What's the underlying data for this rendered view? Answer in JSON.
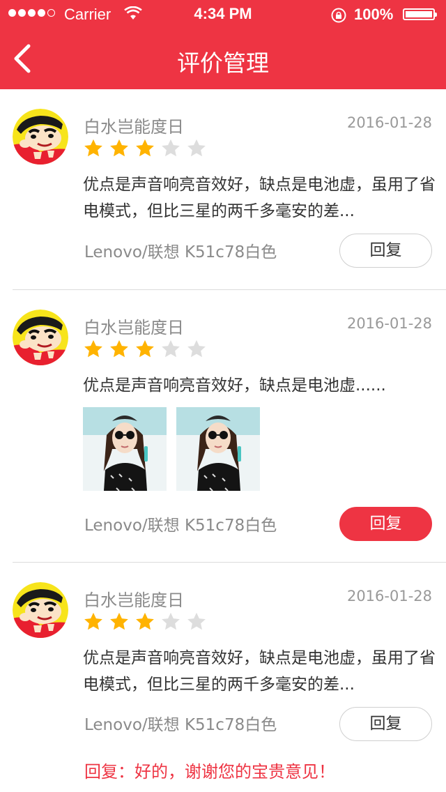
{
  "status_bar": {
    "carrier": "Carrier",
    "time": "4:34 PM",
    "battery": "100%",
    "signal_strength": "4 of 5 bars"
  },
  "nav": {
    "back_icon": "chevron-left-icon",
    "title": "评价管理"
  },
  "colors": {
    "brand": "#ee3443",
    "star_filled": "#ffb300",
    "star_empty": "#dddddd",
    "secondary_text": "#8a8a8a"
  },
  "reviews": [
    {
      "username": "白水岂能度日",
      "date": "2016-01-28",
      "rating": 3,
      "rating_max": 5,
      "content": "优点是声音响亮音效好，缺点是电池虚，虽用了省电模式，但比三星的两千多毫安的差...",
      "device": "Lenovo/联想 K51c78白色",
      "reply_label": "回复",
      "reply_active": false
    },
    {
      "username": "白水岂能度日",
      "date": "2016-01-28",
      "rating": 3,
      "rating_max": 5,
      "content": "优点是声音响亮音效好，缺点是电池虚......",
      "photo_count": 2,
      "device": "Lenovo/联想 K51c78白色",
      "reply_label": "回复",
      "reply_active": true
    },
    {
      "username": "白水岂能度日",
      "date": "2016-01-28",
      "rating": 3,
      "rating_max": 5,
      "content": "优点是声音响亮音效好，缺点是电池虚，虽用了省电模式，但比三星的两千多毫安的差...",
      "device": "Lenovo/联想 K51c78白色",
      "reply_label": "回复",
      "reply_active": false,
      "reply_text": "回复：好的，谢谢您的宝贵意见！"
    }
  ]
}
